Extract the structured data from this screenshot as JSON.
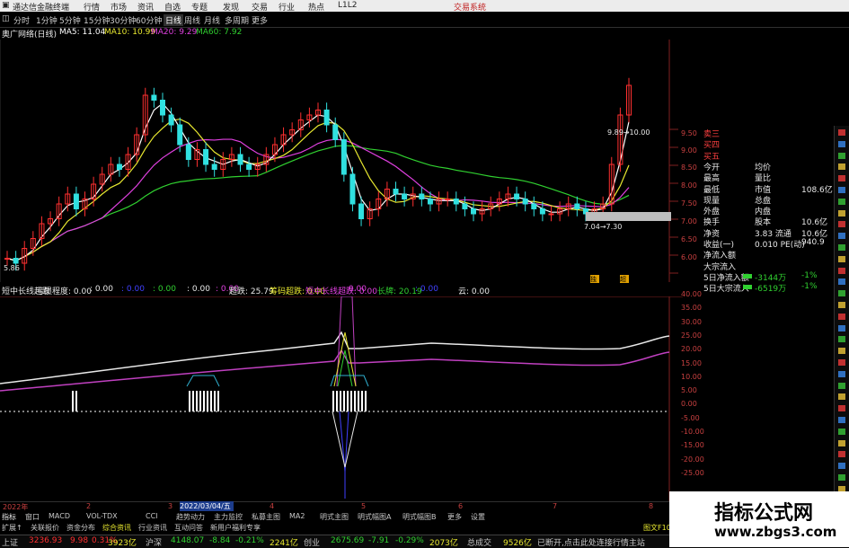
{
  "window": {
    "app_title": "通达信金融终端",
    "menu": [
      "行情",
      "市场",
      "资讯",
      "自选",
      "专题",
      "发现",
      "交易",
      "行业",
      "热点"
    ],
    "version": "L1L2",
    "right_label": "交易系统"
  },
  "toolbar": {
    "periods": [
      "分时",
      "1分钟",
      "5分钟",
      "15分钟",
      "30分钟",
      "60分钟",
      "日线",
      "周线",
      "月线",
      "多周期",
      "更多"
    ],
    "active_period": "日线"
  },
  "main_chart": {
    "stock_name": "奥广网络(日线)",
    "ma_labels": [
      {
        "text": "MA5: 11.04",
        "color": "#ffffff"
      },
      {
        "text": "MA10: 10.99",
        "color": "#e8e830"
      },
      {
        "text": "MA20: 9.29",
        "color": "#e040e0"
      },
      {
        "text": "MA60: 7.92",
        "color": "#30d030"
      }
    ],
    "high_label": "9.89→10.00",
    "low_label": "5.86",
    "range_label": "7.04→7.30",
    "price_ticks": [
      "9.50",
      "9.00",
      "8.50",
      "8.00",
      "7.50",
      "7.00",
      "6.50",
      "6.00"
    ],
    "price_tag": "7.00",
    "markers": [
      "独",
      "超"
    ]
  },
  "indicator": {
    "labels": [
      {
        "text": "短中长线超跌",
        "color": "#e8e8e8"
      },
      {
        "text": "亏损程度: 0.00",
        "color": "#e8e8e8"
      },
      {
        "text": ": 0.00",
        "color": "#e8e8e8"
      },
      {
        "text": ": 0.00",
        "color": "#4040ff"
      },
      {
        "text": ": 0.00",
        "color": "#30d030"
      },
      {
        "text": ": 0.00",
        "color": "#e8e8e8"
      },
      {
        "text": ": 0.00",
        "color": "#e040e0"
      },
      {
        "text": "超跌: 25.79",
        "color": "#e8e8e8"
      },
      {
        "text": "筹码超跌: 0.00",
        "color": "#e8e830"
      },
      {
        "text": "短中长线超跌: 0.00",
        "color": "#e040e0"
      },
      {
        "text": ": 0.00",
        "color": "#e040e0"
      },
      {
        "text": "长牌: 20.19",
        "color": "#30d030"
      },
      {
        "text": ": 0.00",
        "color": "#4040ff"
      },
      {
        "text": "云: 0.00",
        "color": "#e8e8e8"
      }
    ],
    "y_ticks": [
      "40.00",
      "35.00",
      "30.00",
      "25.00",
      "20.00",
      "15.00",
      "10.00",
      "5.00",
      "0.00",
      "-5.00",
      "-10.00",
      "-15.00",
      "-20.00",
      "-25.00"
    ]
  },
  "time_axis": {
    "labels": [
      "2022年",
      "2",
      "3",
      "4",
      "5",
      "6",
      "7",
      "8"
    ],
    "selected_date": "2022/03/04/五"
  },
  "right_panel": {
    "rows": [
      {
        "left": "卖三",
        "mid": "",
        "right": ""
      },
      {
        "left": "买四",
        "mid": "",
        "right": ""
      },
      {
        "left": "买五",
        "mid": "",
        "right": ""
      },
      {
        "left": "今开",
        "mid": "均价",
        "right": ""
      },
      {
        "left": "最高",
        "mid": "量比",
        "right": ""
      },
      {
        "left": "最低",
        "mid": "市值",
        "right": "108.6亿"
      },
      {
        "left": "现量",
        "mid": "总盘",
        "right": ""
      },
      {
        "left": "外盘",
        "mid": "内盘",
        "right": ""
      },
      {
        "left": "换手",
        "mid": "股本",
        "right": "10.6亿"
      },
      {
        "left": "净资",
        "mid": "3.83 流通",
        "right": "10.6亿"
      },
      {
        "left": "收益(一)",
        "mid": "0.010 PE(动)",
        "right": "940.9"
      },
      {
        "left": "净流入额",
        "mid": "",
        "right": ""
      },
      {
        "left": "大宗流入",
        "mid": "",
        "right": ""
      },
      {
        "left": "5日净流入额",
        "mid": "-3144万",
        "right": "-1%"
      },
      {
        "left": "5日大宗流入",
        "mid": "-6519万",
        "right": "-1%"
      }
    ]
  },
  "bottom_tabs": {
    "row1": [
      "指标",
      "窗口",
      "MACD",
      "VOL-TDX",
      "CCI",
      "趋势动力",
      "主力监控",
      "私募主图",
      "MA2",
      "明式主图",
      "明式幅图A",
      "明式幅图B",
      "更多",
      "设置"
    ],
    "row2": [
      "扩展↑",
      "关联报价",
      "资金分布",
      "综合资讯",
      "行业资讯",
      "互动问答",
      "新用户福利专享"
    ],
    "right": "图文F10"
  },
  "status_bar": {
    "items": [
      {
        "text": "上证",
        "color": "#c8c8c8"
      },
      {
        "text": "3236.93",
        "color": "#ff3030"
      },
      {
        "text": "9.98",
        "color": "#ff3030"
      },
      {
        "text": "0.31%",
        "color": "#ff3030"
      },
      {
        "text": "3923亿",
        "color": "#e8e830"
      },
      {
        "text": "沪深",
        "color": "#c8c8c8"
      },
      {
        "text": "4148.07",
        "color": "#30d030"
      },
      {
        "text": "-8.84",
        "color": "#30d030"
      },
      {
        "text": "-0.21%",
        "color": "#30d030"
      },
      {
        "text": "2241亿",
        "color": "#e8e830"
      },
      {
        "text": "创业",
        "color": "#c8c8c8"
      },
      {
        "text": "2675.69",
        "color": "#30d030"
      },
      {
        "text": "-7.91",
        "color": "#30d030"
      },
      {
        "text": "-0.29%",
        "color": "#30d030"
      },
      {
        "text": "2073亿",
        "color": "#e8e830"
      },
      {
        "text": "总成交",
        "color": "#c8c8c8"
      },
      {
        "text": "9526亿",
        "color": "#e8e830"
      },
      {
        "text": "已断开,点击此处连接行情主站",
        "color": "#c8c8c8"
      }
    ]
  },
  "watermark": {
    "title": "指标公式网",
    "url": "www.zbgs3.com"
  }
}
